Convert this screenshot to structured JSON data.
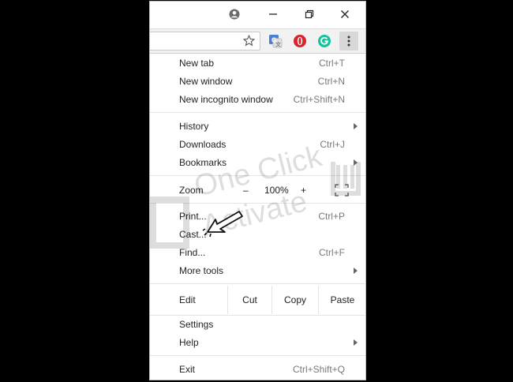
{
  "window": {
    "title_icons": [
      "profile-icon",
      "minimize-icon",
      "restore-icon",
      "close-icon"
    ]
  },
  "toolbar": {
    "bookmark_icon": "star-icon",
    "extensions": [
      {
        "name": "google-translate-icon",
        "color": "#4a7fd7"
      },
      {
        "name": "opera-vpn-icon",
        "color": "#d9232d"
      },
      {
        "name": "grammarly-icon",
        "color": "#15c39a"
      }
    ],
    "menu_icon": "vertical-dots-icon"
  },
  "menu": {
    "new_tab": {
      "label": "New tab",
      "shortcut": "Ctrl+T"
    },
    "new_window": {
      "label": "New window",
      "shortcut": "Ctrl+N"
    },
    "new_incognito": {
      "label": "New incognito window",
      "shortcut": "Ctrl+Shift+N"
    },
    "history": {
      "label": "History"
    },
    "downloads": {
      "label": "Downloads",
      "shortcut": "Ctrl+J"
    },
    "bookmarks": {
      "label": "Bookmarks"
    },
    "zoom": {
      "label": "Zoom",
      "minus": "–",
      "level": "100%",
      "plus": "+"
    },
    "print": {
      "label": "Print...",
      "shortcut": "Ctrl+P"
    },
    "cast": {
      "label": "Cast..."
    },
    "find": {
      "label": "Find...",
      "shortcut": "Ctrl+F"
    },
    "more_tools": {
      "label": "More tools"
    },
    "edit": {
      "label": "Edit",
      "cut": "Cut",
      "copy": "Copy",
      "paste": "Paste"
    },
    "settings": {
      "label": "Settings"
    },
    "help": {
      "label": "Help"
    },
    "exit": {
      "label": "Exit",
      "shortcut": "Ctrl+Shift+Q"
    }
  },
  "watermark": {
    "line1": "One Click",
    "line2": "Activate"
  }
}
